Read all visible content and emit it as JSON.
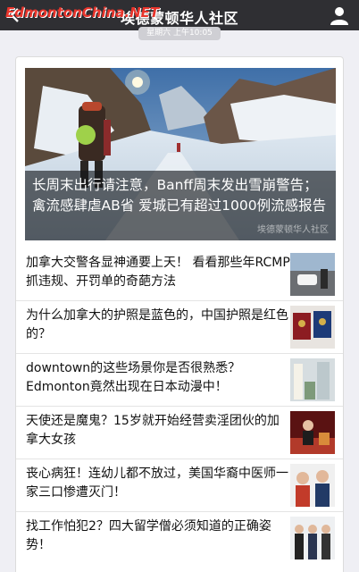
{
  "header": {
    "title": "埃德蒙顿华人社区",
    "watermark": "EdmontonChina.NET",
    "back_icon": "back-arrow-icon",
    "profile_icon": "person-icon"
  },
  "timestamp": "星期六 上午10:05",
  "feature": {
    "title": "长周末出行请注意，Banff周末发出雪崩警告；禽流感肆虐AB省 爱城已有超过1000例流感报告",
    "source": "埃德蒙顿华人社区"
  },
  "articles": [
    {
      "title": "加拿大交警各显神通要上天！ 看看那些年RCMP抓违规、开罚单的奇葩方法"
    },
    {
      "title": "为什么加拿大的护照是蓝色的，中国护照是红色的？"
    },
    {
      "title": "downtown的这些场景你是否很熟悉？Edmonton竟然出现在日本动漫中！"
    },
    {
      "title": "天使还是魔鬼？15岁就开始经营卖淫团伙的加拿大女孩"
    },
    {
      "title": "丧心病狂！连幼儿都不放过，美国华裔中医师一家三口惨遭灭门！"
    },
    {
      "title": "找工作怕犯2？四大留学僧必须知道的正确姿势！"
    }
  ],
  "colors": {
    "topbar": "#2f2f33",
    "watermark": "#e8342b",
    "background": "#efeff4"
  }
}
